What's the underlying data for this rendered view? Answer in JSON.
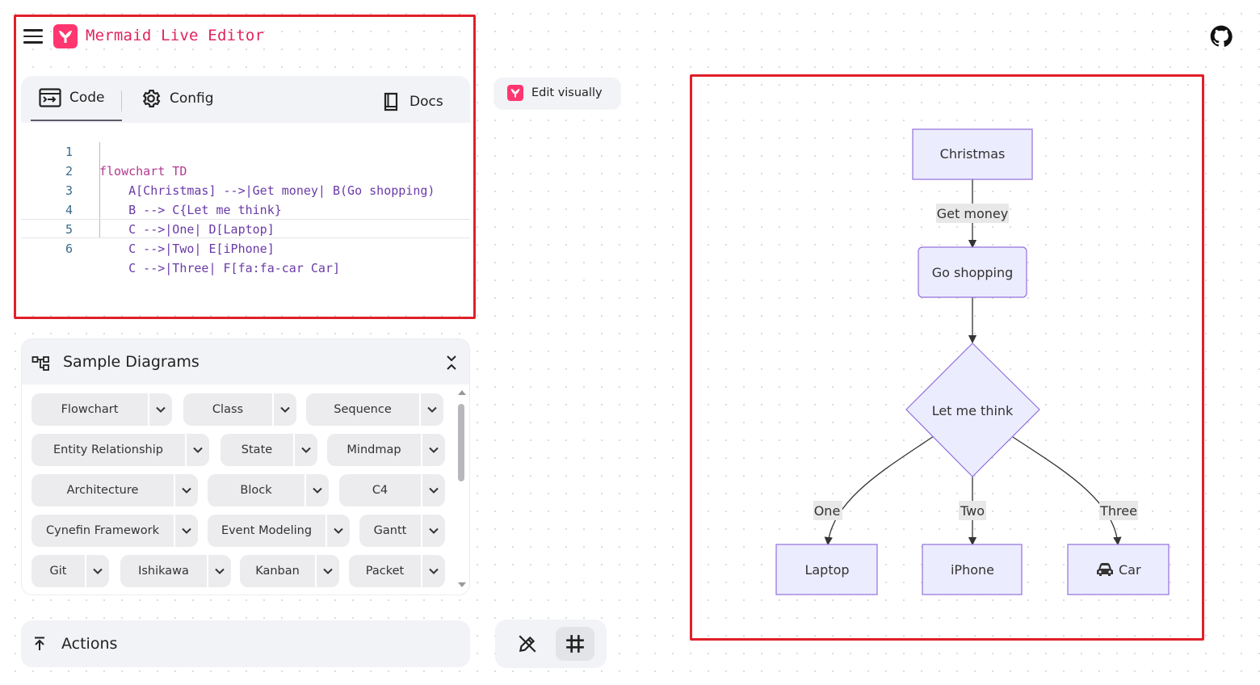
{
  "header": {
    "title": "Mermaid Live Editor"
  },
  "editor": {
    "tabs": [
      {
        "label": "Code"
      },
      {
        "label": "Config"
      },
      {
        "label": "Docs"
      }
    ],
    "lines": [
      {
        "num": "1",
        "text": "flowchart TD"
      },
      {
        "num": "2",
        "text": "    A[Christmas] -->|Get money| B(Go shopping)"
      },
      {
        "num": "3",
        "text": "    B --> C{Let me think}"
      },
      {
        "num": "4",
        "text": "    C -->|One| D[Laptop]"
      },
      {
        "num": "5",
        "text": "    C -->|Two| E[iPhone]"
      },
      {
        "num": "6",
        "text": "    C -->|Three| F[fa:fa-car Car]"
      }
    ]
  },
  "edit_visually": {
    "label": "Edit visually"
  },
  "samples": {
    "title": "Sample Diagrams",
    "items": [
      {
        "label": "Flowchart"
      },
      {
        "label": "Class"
      },
      {
        "label": "Sequence"
      },
      {
        "label": "Entity Relationship"
      },
      {
        "label": "State"
      },
      {
        "label": "Mindmap"
      },
      {
        "label": "Architecture"
      },
      {
        "label": "Block"
      },
      {
        "label": "C4"
      },
      {
        "label": "Cynefin Framework"
      },
      {
        "label": "Event Modeling"
      },
      {
        "label": "Gantt"
      },
      {
        "label": "Git"
      },
      {
        "label": "Ishikawa"
      },
      {
        "label": "Kanban"
      },
      {
        "label": "Packet"
      }
    ]
  },
  "actions": {
    "label": "Actions"
  },
  "diagram": {
    "nodes": {
      "christmas": "Christmas",
      "go_shopping": "Go shopping",
      "let_me_think": "Let me think",
      "laptop": "Laptop",
      "iphone": "iPhone",
      "car": "Car"
    },
    "edges": {
      "get_money": "Get money",
      "one": "One",
      "two": "Two",
      "three": "Three"
    }
  },
  "colors": {
    "brand": "#ff3670",
    "title": "#e0245e",
    "highlight": "#e0202a",
    "node_fill": "#ECECFF",
    "node_stroke": "#9370DB"
  }
}
